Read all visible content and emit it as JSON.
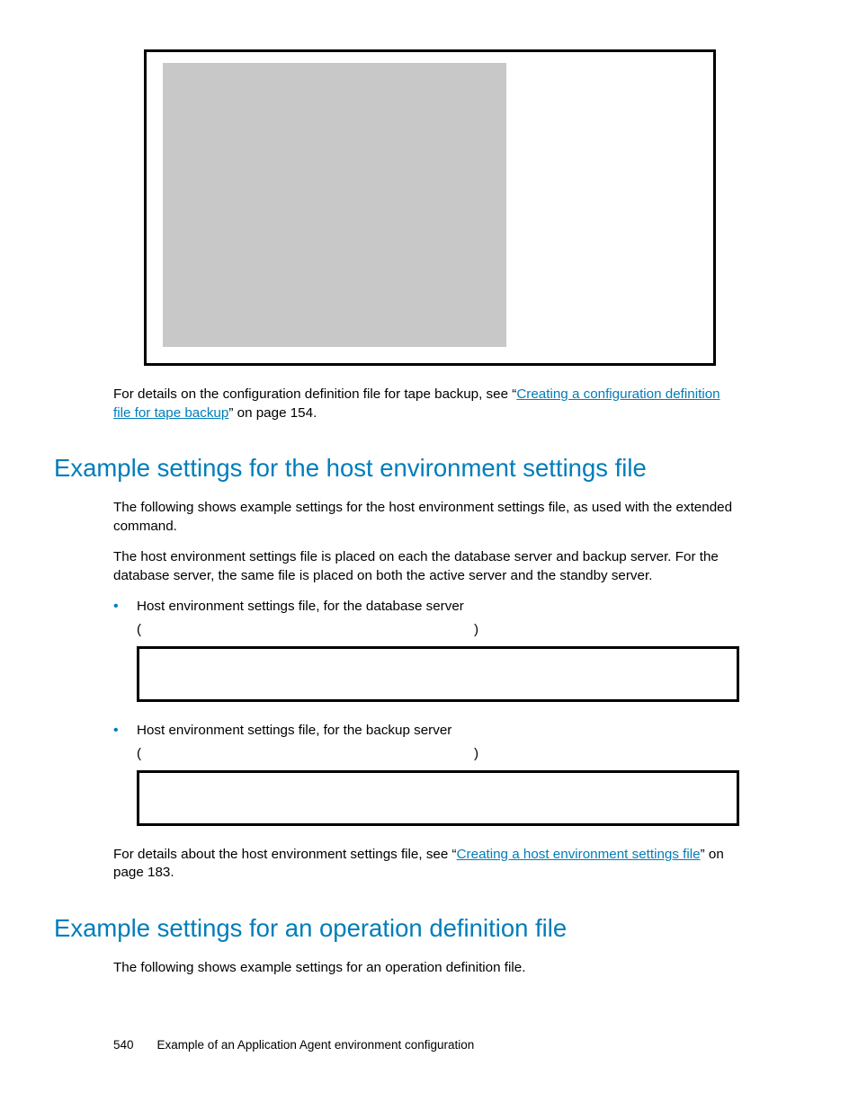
{
  "para1": {
    "lead": "For details on the configuration definition file for tape backup, see “",
    "link": "Creating a configuration definition file for tape backup",
    "tail": "” on page 154."
  },
  "sectionA": {
    "title": "Example settings for the host environment settings file",
    "p1": "The following shows example settings for the host environment settings file, as used with the extended command.",
    "p2": "The host environment settings file is placed on each the database server and backup server. For the database server, the same file is placed on both the active server and the standby server.",
    "items": [
      {
        "label": "Host environment settings file, for the database server",
        "lp": "(",
        "rp": ")"
      },
      {
        "label": "Host environment settings file, for the backup server",
        "lp": "(",
        "rp": ")"
      }
    ],
    "closing": {
      "lead": "For details about the host environment settings file, see “",
      "link": "Creating a host environment settings file",
      "tail": "” on page 183."
    }
  },
  "sectionB": {
    "title": "Example settings for an operation definition file",
    "p1": "The following shows example settings for an operation definition file."
  },
  "footer": {
    "page": "540",
    "title": "Example of an Application Agent environment configuration"
  }
}
